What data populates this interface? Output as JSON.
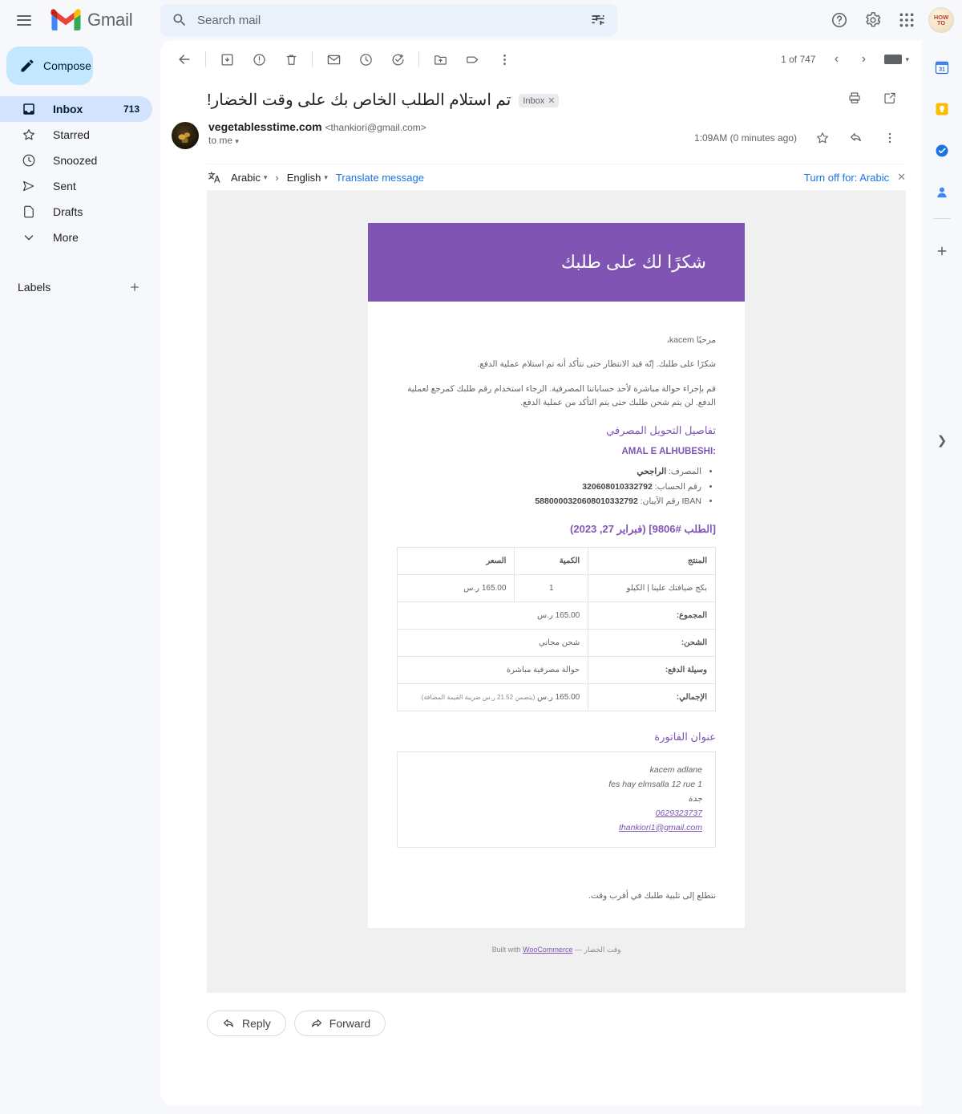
{
  "app": {
    "brand": "Gmail",
    "avatar_text": "HOW TO"
  },
  "search": {
    "placeholder": "Search mail",
    "value": ""
  },
  "sidebar": {
    "compose_label": "Compose",
    "items": [
      {
        "label": "Inbox",
        "count": "713",
        "icon": "inbox-icon"
      },
      {
        "label": "Starred",
        "count": "",
        "icon": "star-icon"
      },
      {
        "label": "Snoozed",
        "count": "",
        "icon": "clock-icon"
      },
      {
        "label": "Sent",
        "count": "",
        "icon": "send-icon"
      },
      {
        "label": "Drafts",
        "count": "",
        "icon": "draft-icon"
      },
      {
        "label": "More",
        "count": "",
        "icon": "chevron-down-icon"
      }
    ],
    "labels_header": "Labels"
  },
  "toolbar": {
    "icons": [
      "back-arrow-icon",
      "archive-icon",
      "report-spam-icon",
      "delete-icon",
      "mark-unread-icon",
      "snooze-icon",
      "add-to-tasks-icon",
      "move-to-icon",
      "label-icon",
      "more-options-icon"
    ],
    "pagecount": "1 of 747"
  },
  "message": {
    "subject": "تم استلام الطلب الخاص بك على وقت الخضار!",
    "chip_label": "Inbox",
    "sender_name": "vegetablesstime.com",
    "sender_email": "<thankiori@gmail.com>",
    "to_line": "to me",
    "timestamp": "1:09AM (0 minutes ago)"
  },
  "translate": {
    "source_lang": "Arabic",
    "target_lang": "English",
    "action": "Translate message",
    "turn_off": "Turn off for: Arabic",
    "close": "✕"
  },
  "email": {
    "banner_title": "شكرًا لك على طلبك",
    "greeting": "مرحبًا kacem،",
    "para1": "شكرًا على طلبك. إنّه قيد الانتظار حتى نتأكد أنه تم استلام عملية الدفع.",
    "para2": "قم بإجراء حوالة مباشرة لأحد حساباتنا المصرفية. الرجاء استخدام رقم طلبك كمرجع لعملية الدفع. لن يتم شحن طلبك حتى يتم التأكد من عملية الدفع.",
    "bank_heading": "تفاصيل التحويل المصرفي",
    "bank_account_name": "AMAL E ALHUBESHI:",
    "bank_lines": [
      {
        "label": "المصرف:",
        "value": "الراجحي"
      },
      {
        "label": "رقم الحساب:",
        "value": "320608010332792"
      },
      {
        "label": "IBAN رقم الآيبان:",
        "value": "5880000320608010332792"
      }
    ],
    "order_heading": "[الطلب #9806] (فبراير 27, 2023)",
    "table": {
      "headers": [
        "المنتج",
        "الكمية",
        "السعر"
      ],
      "rows": [
        {
          "product": "بكج ضيافتك علينا | الكيلو",
          "qty": "1",
          "price": "165.00 ر.س"
        }
      ],
      "totals": [
        {
          "label": "المجموع:",
          "value": "165.00 ر.س",
          "note": ""
        },
        {
          "label": "الشحن:",
          "value": "شحن مجاني",
          "note": ""
        },
        {
          "label": "وسيلة الدفع:",
          "value": "حوالة مصرفية مباشرة",
          "note": ""
        },
        {
          "label": "الإجمالي:",
          "value": "165.00 ر.س",
          "note": "(يتضمن 21.52 ر.س ضريبة القيمة المضافة)"
        }
      ]
    },
    "address_heading": "عنوان الفاتورة",
    "address": {
      "name": "kacem adlane",
      "street": "fes hay elmsalla 12 rue 1",
      "city": "جدة",
      "phone": "0629323737",
      "email": "thankiori1@gmail.com"
    },
    "closing": "نتطلع إلى تلبية طلبك في أقرب وقت.",
    "footer_prefix": "Built with",
    "footer_link": "WooCommerce",
    "footer_suffix": "— وقت الخضار",
    "accent_purple": "#7F54B3"
  },
  "actions": {
    "reply": "Reply",
    "forward": "Forward"
  },
  "rail": {
    "icons": [
      "calendar-icon",
      "keep-icon",
      "tasks-icon",
      "contacts-icon",
      "add-apps-icon",
      "expand-panel-icon"
    ]
  }
}
